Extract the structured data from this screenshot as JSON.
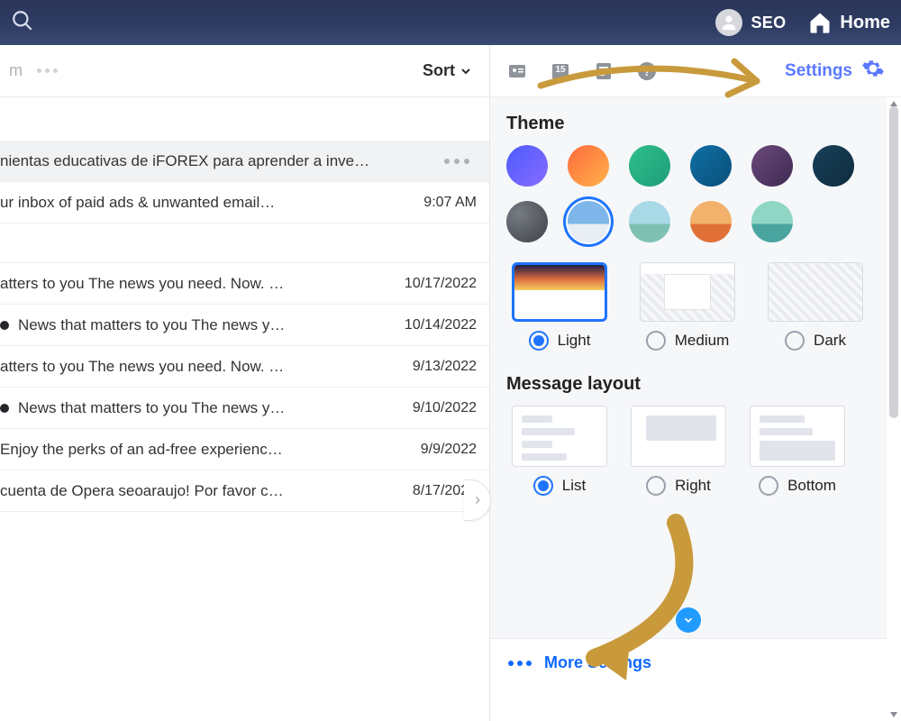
{
  "topbar": {
    "user_label": "SEO",
    "home_label": "Home"
  },
  "list_header": {
    "m_glyph": "m",
    "sort_label": "Sort"
  },
  "emails": [
    {
      "subject": "nientas educativas de iFOREX para aprender a inve…",
      "time": "",
      "selected": true,
      "dotted": false
    },
    {
      "subject": "ur inbox of paid ads & unwanted email…",
      "time": "9:07 AM",
      "selected": false,
      "dotted": false
    },
    {
      "subject": "atters to you The news you need. Now. …",
      "time": "10/17/2022",
      "selected": false,
      "dotted": false
    },
    {
      "subject": "News that matters to you The news y…",
      "time": "10/14/2022",
      "selected": false,
      "dotted": true
    },
    {
      "subject": "atters to you The news you need. Now. …",
      "time": "9/13/2022",
      "selected": false,
      "dotted": false
    },
    {
      "subject": "News that matters to you The news y…",
      "time": "9/10/2022",
      "selected": false,
      "dotted": true
    },
    {
      "subject": "Enjoy the perks of an ad-free experienc…",
      "time": "9/9/2022",
      "selected": false,
      "dotted": false
    },
    {
      "subject": "cuenta de Opera seoaraujo! Por favor c…",
      "time": "8/17/2022",
      "selected": false,
      "dotted": false
    }
  ],
  "panel_top": {
    "calendar_day": "15",
    "settings_label": "Settings"
  },
  "theme": {
    "heading": "Theme",
    "swatches": [
      {
        "name": "violet",
        "bg": "linear-gradient(135deg,#4a5cff,#8a6bff)"
      },
      {
        "name": "sunset",
        "bg": "linear-gradient(135deg,#ff6a3c,#ffb24a)"
      },
      {
        "name": "emerald",
        "bg": "linear-gradient(135deg,#2fbf8a,#1f9d7a)"
      },
      {
        "name": "teal",
        "bg": "linear-gradient(135deg,#0e6fa5,#0b4f7a)"
      },
      {
        "name": "plum",
        "bg": "linear-gradient(135deg,#6b4a7d,#3f2a52)"
      },
      {
        "name": "midnight",
        "bg": "linear-gradient(135deg,#17415a,#0f2c3e)"
      }
    ],
    "swatches2": [
      {
        "name": "graphite",
        "bg": "radial-gradient(circle at 30% 30%,#777c84,#3d4047)"
      },
      {
        "name": "mountain-photo",
        "bg": "linear-gradient(180deg,#7eb6e9 0 55%,#e9eef4 55% 100%)",
        "selected": true
      },
      {
        "name": "car-photo",
        "bg": "linear-gradient(180deg,#a9d8e6 0 55%,#7ec1b3 55% 100%)"
      },
      {
        "name": "desert-photo",
        "bg": "linear-gradient(180deg,#f2b26b 0 55%,#e07038 55% 100%)"
      },
      {
        "name": "island-photo",
        "bg": "linear-gradient(180deg,#8fd7c4 0 55%,#4aa5a0 55% 100%)"
      }
    ],
    "density": [
      {
        "value": "light",
        "label": "Light",
        "selected": true
      },
      {
        "value": "medium",
        "label": "Medium",
        "selected": false
      },
      {
        "value": "dark",
        "label": "Dark",
        "selected": false
      }
    ]
  },
  "layout": {
    "heading": "Message layout",
    "options": [
      {
        "value": "list",
        "label": "List",
        "selected": true
      },
      {
        "value": "right",
        "label": "Right",
        "selected": false
      },
      {
        "value": "bottom",
        "label": "Bottom",
        "selected": false
      }
    ]
  },
  "footer": {
    "more_label": "More Settings",
    "tooltip": "Settings"
  },
  "annotation_color": "#c99a3c"
}
